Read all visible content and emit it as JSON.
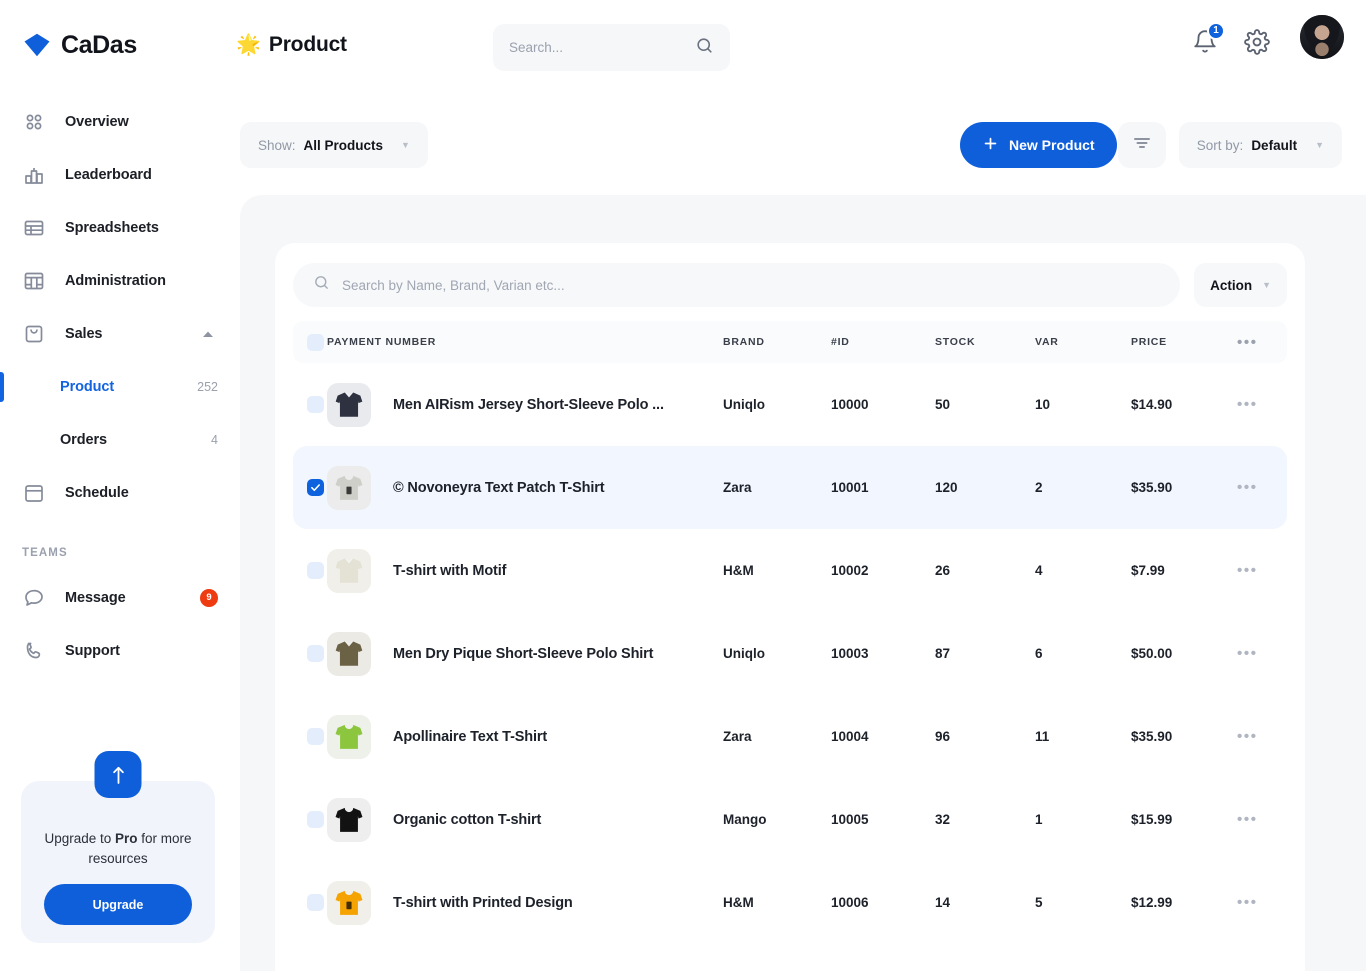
{
  "brand": {
    "name": "CaDas",
    "logo_icon": "diamond-logo-icon"
  },
  "header": {
    "page_emoji": "🌟",
    "page_title": "Product",
    "search_placeholder": "Search...",
    "search_icon": "search-icon",
    "notification_icon": "bell-icon",
    "notification_count": "1",
    "settings_icon": "gear-icon",
    "avatar_name": "user-avatar"
  },
  "sidebar": {
    "items": [
      {
        "label": "Overview",
        "icon": "grid-dots-icon"
      },
      {
        "label": "Leaderboard",
        "icon": "bar-chart-icon"
      },
      {
        "label": "Spreadsheets",
        "icon": "table-icon"
      },
      {
        "label": "Administration",
        "icon": "panels-icon"
      },
      {
        "label": "Sales",
        "icon": "shopping-bag-icon",
        "expanded": true
      }
    ],
    "sub_items": [
      {
        "label": "Product",
        "count": "252",
        "active": true
      },
      {
        "label": "Orders",
        "count": "4",
        "active": false
      }
    ],
    "after_items": [
      {
        "label": "Schedule",
        "icon": "calendar-icon"
      }
    ],
    "teams_label": "TEAMS",
    "team_items": [
      {
        "label": "Message",
        "icon": "chat-bubble-icon",
        "badge": "9"
      },
      {
        "label": "Support",
        "icon": "phone-icon",
        "badge": ""
      }
    ],
    "upgrade": {
      "icon": "arrow-up-icon",
      "text_before": "Upgrade to ",
      "text_bold": "Pro",
      "text_after": " for more resources",
      "button_label": "Upgrade"
    }
  },
  "toolbar": {
    "show_label": "Show:",
    "show_value": "All Products",
    "new_product_label": "New Product",
    "plus_icon": "plus-icon",
    "filter_icon": "filter-icon",
    "sort_label": "Sort by:",
    "sort_value": "Default"
  },
  "table": {
    "search_placeholder": "Search by Name, Brand, Varian etc...",
    "search_icon": "search-icon",
    "action_label": "Action",
    "more_icon": "more-horizontal-icon",
    "headers": {
      "name": "PAYMENT NUMBER",
      "brand": "BRAND",
      "id": "#ID",
      "stock": "STOCK",
      "var": "VAR",
      "price": "PRICE"
    },
    "rows": [
      {
        "name": "Men AIRism Jersey Short-Sleeve Polo ...",
        "brand": "Uniqlo",
        "id": "10000",
        "stock": "50",
        "var": "10",
        "price": "$14.90",
        "selected": false,
        "thumb_color": "#2d3140",
        "thumb_bg": "#e9eaee",
        "thumb_type": "polo"
      },
      {
        "name": "© Novoneyra Text Patch T-Shirt",
        "brand": "Zara",
        "id": "10001",
        "stock": "120",
        "var": "2",
        "price": "$35.90",
        "selected": true,
        "thumb_color": "#cfcfc9",
        "thumb_bg": "#ebeceb",
        "thumb_type": "tee-patch"
      },
      {
        "name": "T-shirt with Motif",
        "brand": "H&M",
        "id": "10002",
        "stock": "26",
        "var": "4",
        "price": "$7.99",
        "selected": false,
        "thumb_color": "#e4e1d5",
        "thumb_bg": "#f0efe9",
        "thumb_type": "polo"
      },
      {
        "name": "Men Dry Pique Short-Sleeve Polo Shirt",
        "brand": "Uniqlo",
        "id": "10003",
        "stock": "87",
        "var": "6",
        "price": "$50.00",
        "selected": false,
        "thumb_color": "#6b6145",
        "thumb_bg": "#eceae4",
        "thumb_type": "polo"
      },
      {
        "name": "Apollinaire Text T-Shirt",
        "brand": "Zara",
        "id": "10004",
        "stock": "96",
        "var": "11",
        "price": "$35.90",
        "selected": false,
        "thumb_color": "#8cc63f",
        "thumb_bg": "#eef0ea",
        "thumb_type": "tee"
      },
      {
        "name": "Organic cotton T-shirt",
        "brand": "Mango",
        "id": "10005",
        "stock": "32",
        "var": "1",
        "price": "$15.99",
        "selected": false,
        "thumb_color": "#121212",
        "thumb_bg": "#eeeeee",
        "thumb_type": "tee"
      },
      {
        "name": "T-shirt with Printed Design",
        "brand": "H&M",
        "id": "10006",
        "stock": "14",
        "var": "5",
        "price": "$12.99",
        "selected": false,
        "thumb_color": "#f5a300",
        "thumb_bg": "#f0efe9",
        "thumb_type": "tee-patch"
      }
    ]
  },
  "colors": {
    "accent": "#0f5fdb",
    "accent_alt": "#1364e0",
    "danger": "#ee3b11",
    "selected_row": "#f2f6fe",
    "panel_bg": "#f6f7f9"
  }
}
